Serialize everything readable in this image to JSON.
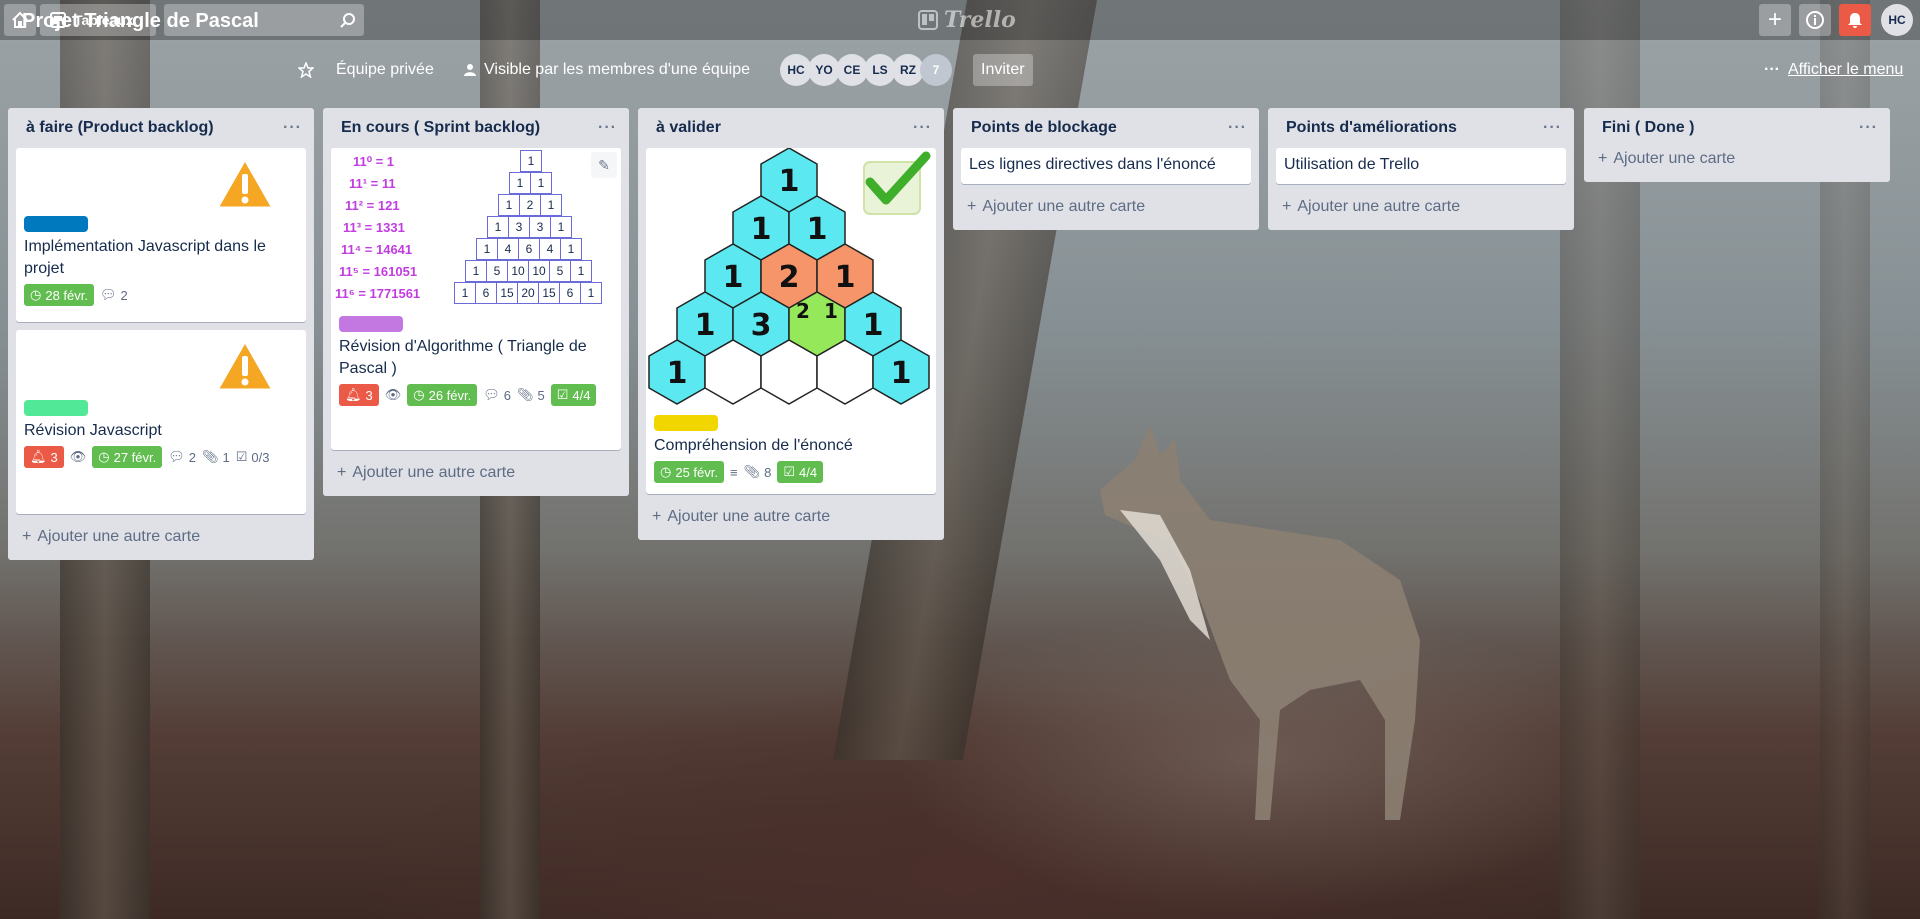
{
  "topbar": {
    "boards_label": "Tableaux",
    "logo": "Trello",
    "user_initials": "HC"
  },
  "board": {
    "title": "Projet Triangle de Pascal",
    "team": "Équipe privée",
    "visibility": "Visible par les membres d'une équipe",
    "invite": "Inviter",
    "menu": "Afficher le menu",
    "members": [
      "HC",
      "YO",
      "CE",
      "LS",
      "RZ"
    ],
    "members_more": "7"
  },
  "lists": [
    {
      "title": "à faire (Product backlog)",
      "add": "Ajouter une autre carte",
      "cards": [
        {
          "label_color": "#0079bf",
          "title": "Implémentation Javascript dans le projet",
          "due": "28 févr.",
          "comments": "2"
        },
        {
          "label_color": "#51e898",
          "title": "Révision Javascript",
          "notifications": "3",
          "due": "27 févr.",
          "comments": "2",
          "attachments": "1",
          "checklist": "0/3"
        }
      ]
    },
    {
      "title": "En cours ( Sprint backlog)",
      "add": "Ajouter une autre carte",
      "cards": [
        {
          "label_color": "#c377e0",
          "title": "Révision d'Algorithme ( Triangle de Pascal )",
          "notifications": "3",
          "due": "26 févr.",
          "comments": "6",
          "attachments": "5",
          "checklist": "4/4",
          "cover": {
            "powers": [
              "11⁰ = 1",
              "11¹ = 11",
              "11² = 121",
              "11³ = 1331",
              "11⁴ = 14641",
              "11⁵ = 161051",
              "11⁶ = 1771561"
            ],
            "rows": [
              [
                "1"
              ],
              [
                "1",
                "1"
              ],
              [
                "1",
                "2",
                "1"
              ],
              [
                "1",
                "3",
                "3",
                "1"
              ],
              [
                "1",
                "4",
                "6",
                "4",
                "1"
              ],
              [
                "1",
                "5",
                "10",
                "10",
                "5",
                "1"
              ],
              [
                "1",
                "6",
                "15",
                "20",
                "15",
                "6",
                "1"
              ]
            ]
          }
        }
      ]
    },
    {
      "title": "à valider",
      "add": "Ajouter une autre carte",
      "cards": [
        {
          "label_color": "#f2d600",
          "title": "Compréhension de l'énoncé",
          "due": "25 févr.",
          "attachments": "8",
          "checklist": "4/4"
        }
      ]
    },
    {
      "title": "Points de blockage",
      "add": "Ajouter une autre carte",
      "cards": [
        {
          "title": "Les lignes directives dans l'énoncé"
        }
      ]
    },
    {
      "title": "Points d'améliorations",
      "add": "Ajouter une autre carte",
      "cards": [
        {
          "title": "Utilisation de Trello"
        }
      ]
    },
    {
      "title": "Fini ( Done )",
      "add": "Ajouter une carte",
      "cards": []
    }
  ],
  "colors": {
    "due_green": "#61bd4f",
    "alert_red": "#eb5a46",
    "hex_cyan": "#5ce8f0",
    "hex_orange": "#f7956a",
    "hex_green": "#95e85a"
  }
}
